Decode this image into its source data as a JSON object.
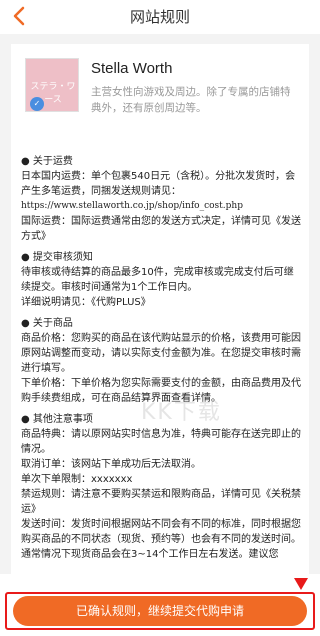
{
  "header": {
    "title": "网站规则"
  },
  "shop": {
    "logo_text": "ステラ・ワース",
    "name": "Stella Worth",
    "description": "主营女性向游戏及周边。除了专属的店铺特典外，还有原创周边等。"
  },
  "sections": [
    {
      "heading": "● 关于运费",
      "lines": [
        "日本国内运费：单个包裹540日元（含税）。分批次发货时，会产生多笔运费，同捆发送规则请见：",
        "https://www.stellaworth.co.jp/shop/info_cost.php",
        "国际运费：国际运费通常由您的发送方式决定，详情可见《发送方式》"
      ]
    },
    {
      "heading": "● 提交审核须知",
      "lines": [
        "待审核或待结算的商品最多10件，完成审核或完成支付后可继续提交。审核时间通常为1个工作日内。",
        "详细说明请见：《代购PLUS》"
      ]
    },
    {
      "heading": "● 关于商品",
      "lines": [
        "商品价格：您购买的商品在该代购站显示的价格，该费用可能因原网站调整而变动，请以实际支付金额为准。在您提交审核时需进行填写。",
        "下单价格：下单价格为您实际需要支付的金额，由商品费用及代购手续费组成，可在商品结算界面查看详情。"
      ]
    },
    {
      "heading": "● 其他注意事项",
      "lines": [
        "商品特典：请以原网站实时信息为准，特典可能存在送完即止的情况。",
        "取消订单：该网站下单成功后无法取消。",
        "单次下单限制：xxxxxxx",
        "禁运规则：请注意不要购买禁运和限购商品，详情可见《关税禁运》",
        "发送时间：发货时间根据网站不同会有不同的标准，同时根据您购买商品的不同状态（现货、预约等）也会有不同的发送时间。通常情况下现货商品会在3~14个工作日左右发送。建议您"
      ]
    }
  ],
  "watermark": "KK下载",
  "footer": {
    "confirm_label": "已确认规则，继续提交代购申请"
  },
  "colors": {
    "accent": "#f06a25",
    "highlight": "#e81a1a",
    "back_icon": "#f06a25"
  }
}
